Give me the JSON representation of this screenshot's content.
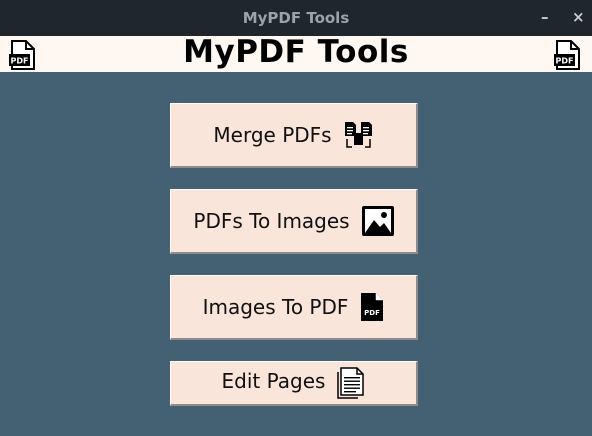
{
  "window": {
    "title": "MyPDF Tools",
    "minimize_glyph": "–",
    "close_glyph": "×"
  },
  "header": {
    "title": "MyPDF Tools",
    "left_icon": "pdf-file-icon",
    "right_icon": "pdf-file-icon",
    "icon_text": "PDF"
  },
  "buttons": {
    "merge": {
      "label": "Merge PDFs",
      "icon": "merge-documents-icon"
    },
    "to_images": {
      "label": "PDFs To Images",
      "icon": "image-icon"
    },
    "to_pdf": {
      "label": "Images To PDF",
      "icon": "pdf-file-icon",
      "icon_text": "PDF"
    },
    "edit": {
      "label": "Edit Pages",
      "icon": "pages-icon"
    }
  },
  "colors": {
    "background": "#446073",
    "button": "#f9e5da",
    "header": "#fff7f1",
    "titlebar": "#1f272c"
  }
}
